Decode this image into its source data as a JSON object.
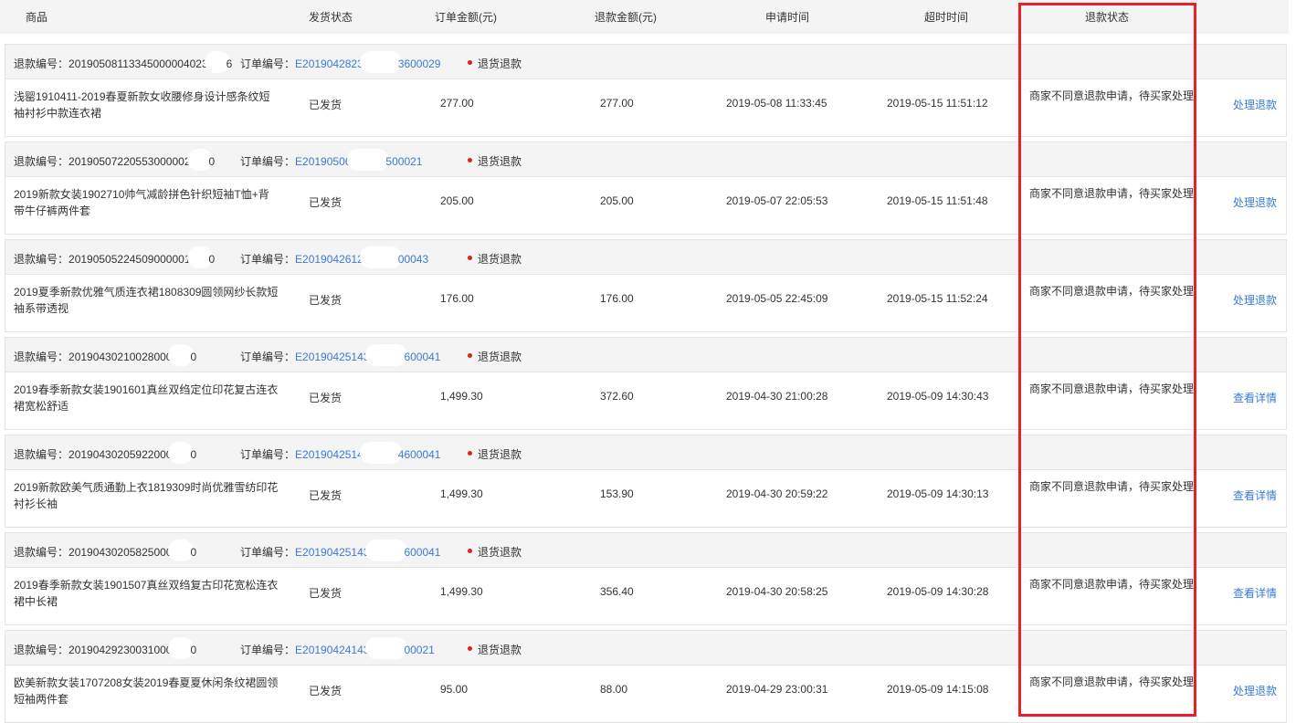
{
  "header": {
    "product": "商品",
    "ship_status": "发货状态",
    "order_amount": "订单金额(元)",
    "refund_amount": "退款金额(元)",
    "apply_time": "申请时间",
    "timeout_time": "超时时间",
    "refund_status": "退款状态"
  },
  "labels": {
    "refund_no": "退款编号：",
    "order_no": "订单编号：",
    "refund_type": "退货退款"
  },
  "colors": {
    "accent": "#3a7bd5",
    "dot": "#e02020",
    "highlight": "#e8202a"
  },
  "rows": [
    {
      "refund_no_a": "20190508113345000004023",
      "refund_no_b": "6",
      "order_no_a": "E2019042823",
      "order_no_b": "3600029",
      "product": "浅罂1910411-2019春夏新款女收腰修身设计感条纹短袖衬衫中款连衣裙",
      "ship_status": "已发货",
      "order_amount": "277.00",
      "refund_amount": "277.00",
      "apply_time": "2019-05-08 11:33:45",
      "timeout_time": "2019-05-15 11:51:12",
      "status": "商家不同意退款申请，待买家处理",
      "action": "处理退款"
    },
    {
      "refund_no_a": "20190507220553000002",
      "refund_no_b": "0",
      "order_no_a": "E20190506",
      "order_no_b": "500021",
      "product": "2019新款女装1902710帅气减龄拼色针织短袖T恤+背带牛仔裤两件套",
      "ship_status": "已发货",
      "order_amount": "205.00",
      "refund_amount": "205.00",
      "apply_time": "2019-05-07 22:05:53",
      "timeout_time": "2019-05-15 11:51:48",
      "status": "商家不同意退款申请，待买家处理",
      "action": "处理退款"
    },
    {
      "refund_no_a": "20190505224509000001",
      "refund_no_b": "0",
      "order_no_a": "E2019042612",
      "order_no_b": "00043",
      "product": "2019夏季新款优雅气质连衣裙1808309圆领网纱长款短袖系带透视",
      "ship_status": "已发货",
      "order_amount": "176.00",
      "refund_amount": "176.00",
      "apply_time": "2019-05-05 22:45:09",
      "timeout_time": "2019-05-15 11:52:24",
      "status": "商家不同意退款申请，待买家处理",
      "action": "处理退款"
    },
    {
      "refund_no_a": "20190430210028000",
      "refund_no_b": "0",
      "order_no_a": "E20190425143",
      "order_no_b": "600041",
      "product": "2019春季新款女装1901601真丝双绉定位印花复古连衣裙宽松舒适",
      "ship_status": "已发货",
      "order_amount": "1,499.30",
      "refund_amount": "372.60",
      "apply_time": "2019-04-30 21:00:28",
      "timeout_time": "2019-05-09 14:30:43",
      "status": "商家不同意退款申请，待买家处理",
      "action": "查看详情"
    },
    {
      "refund_no_a": "20190430205922000",
      "refund_no_b": "0",
      "order_no_a": "E2019042514",
      "order_no_b": "4600041",
      "product": "2019新款欧美气质通勤上衣1819309时尚优雅雪纺印花衬衫长袖",
      "ship_status": "已发货",
      "order_amount": "1,499.30",
      "refund_amount": "153.90",
      "apply_time": "2019-04-30 20:59:22",
      "timeout_time": "2019-05-09 14:30:13",
      "status": "商家不同意退款申请，待买家处理",
      "action": "查看详情"
    },
    {
      "refund_no_a": "20190430205825000",
      "refund_no_b": "0",
      "order_no_a": "E20190425143",
      "order_no_b": "600041",
      "product": "2019春季新款女装1901507真丝双绉复古印花宽松连衣裙中长裙",
      "ship_status": "已发货",
      "order_amount": "1,499.30",
      "refund_amount": "356.40",
      "apply_time": "2019-04-30 20:58:25",
      "timeout_time": "2019-05-09 14:30:28",
      "status": "商家不同意退款申请，待买家处理",
      "action": "查看详情"
    },
    {
      "refund_no_a": "20190429230031000",
      "refund_no_b": "0",
      "order_no_a": "E20190424143",
      "order_no_b": "00021",
      "product": "欧美新款女装1707208女装2019春夏夏休闲条纹裙圆领短袖两件套",
      "ship_status": "已发货",
      "order_amount": "95.00",
      "refund_amount": "88.00",
      "apply_time": "2019-04-29 23:00:31",
      "timeout_time": "2019-05-09 14:15:08",
      "status": "商家不同意退款申请，待买家处理",
      "action": "处理退款"
    }
  ]
}
